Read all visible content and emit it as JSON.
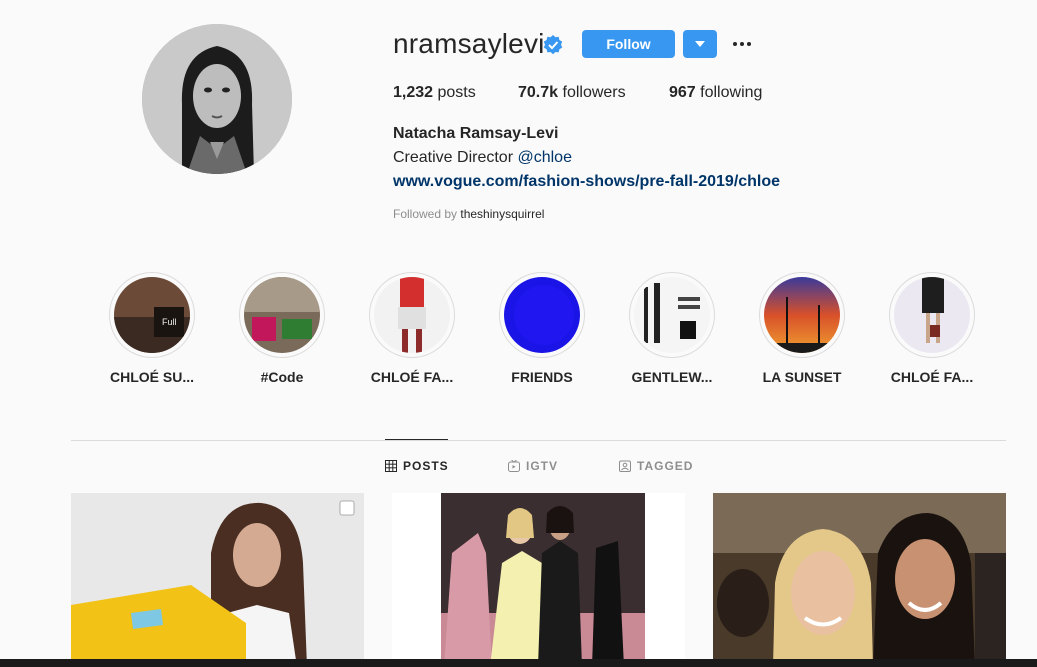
{
  "profile": {
    "username": "nramsaylevi",
    "follow_label": "Follow",
    "stats": {
      "posts_count": "1,232",
      "posts_label": "posts",
      "followers_count": "70.7k",
      "followers_label": "followers",
      "following_count": "967",
      "following_label": "following"
    },
    "full_name": "Natacha Ramsay-Levi",
    "bio_text": "Creative Director ",
    "bio_mention": "@chloe",
    "link": "www.vogue.com/fashion-shows/pre-fall-2019/chloe",
    "followed_by_prefix": "Followed by ",
    "followed_by_user": "theshinysquirrel"
  },
  "highlights": [
    {
      "label": "CHLOÉ SU..."
    },
    {
      "label": "#Code"
    },
    {
      "label": "CHLOÉ FA..."
    },
    {
      "label": "FRIENDS"
    },
    {
      "label": "GENTLEW..."
    },
    {
      "label": "LA SUNSET"
    },
    {
      "label": "CHLOÉ FA..."
    }
  ],
  "tabs": {
    "posts": "POSTS",
    "igtv": "IGTV",
    "tagged": "TAGGED"
  },
  "colors": {
    "accent": "#3897f0",
    "link": "#003569",
    "background": "#fafafa",
    "border": "#dbdbdb",
    "muted": "#8e8e8e"
  },
  "icons": [
    "verified-badge-icon",
    "chevron-down-icon",
    "more-options-icon",
    "grid-icon",
    "igtv-icon",
    "tagged-icon",
    "multi-photo-icon"
  ]
}
